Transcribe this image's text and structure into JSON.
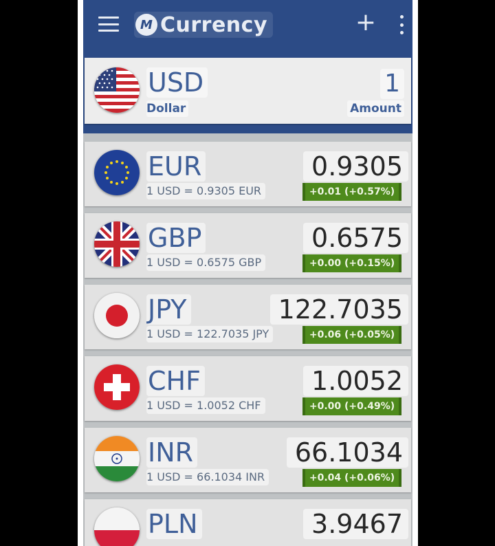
{
  "app": {
    "logo_glyph": "M",
    "title": "Currency",
    "add_glyph": "+"
  },
  "base": {
    "code": "USD",
    "name": "Dollar",
    "amount": "1",
    "amount_label": "Amount",
    "flag_icon": "us-flag-icon"
  },
  "rates": [
    {
      "code": "EUR",
      "conversion": "1 USD = 0.9305 EUR",
      "rate": "0.9305",
      "change": "+0.01 (+0.57%)",
      "flag_icon": "eu-flag-icon"
    },
    {
      "code": "GBP",
      "conversion": "1 USD = 0.6575 GBP",
      "rate": "0.6575",
      "change": "+0.00 (+0.15%)",
      "flag_icon": "uk-flag-icon"
    },
    {
      "code": "JPY",
      "conversion": "1 USD = 122.7035 JPY",
      "rate": "122.7035",
      "change": "+0.06 (+0.05%)",
      "flag_icon": "japan-flag-icon"
    },
    {
      "code": "CHF",
      "conversion": "1 USD = 1.0052 CHF",
      "rate": "1.0052",
      "change": "+0.00 (+0.49%)",
      "flag_icon": "swiss-flag-icon"
    },
    {
      "code": "INR",
      "conversion": "1 USD = 66.1034 INR",
      "rate": "66.1034",
      "change": "+0.04 (+0.06%)",
      "flag_icon": "india-flag-icon"
    },
    {
      "code": "PLN",
      "conversion": "",
      "rate": "3.9467",
      "change": "",
      "flag_icon": "poland-flag-icon"
    }
  ],
  "colors": {
    "appbar": "#2c4b86",
    "accent_text": "#3f5f98",
    "change_positive": "#4e8a1c"
  }
}
